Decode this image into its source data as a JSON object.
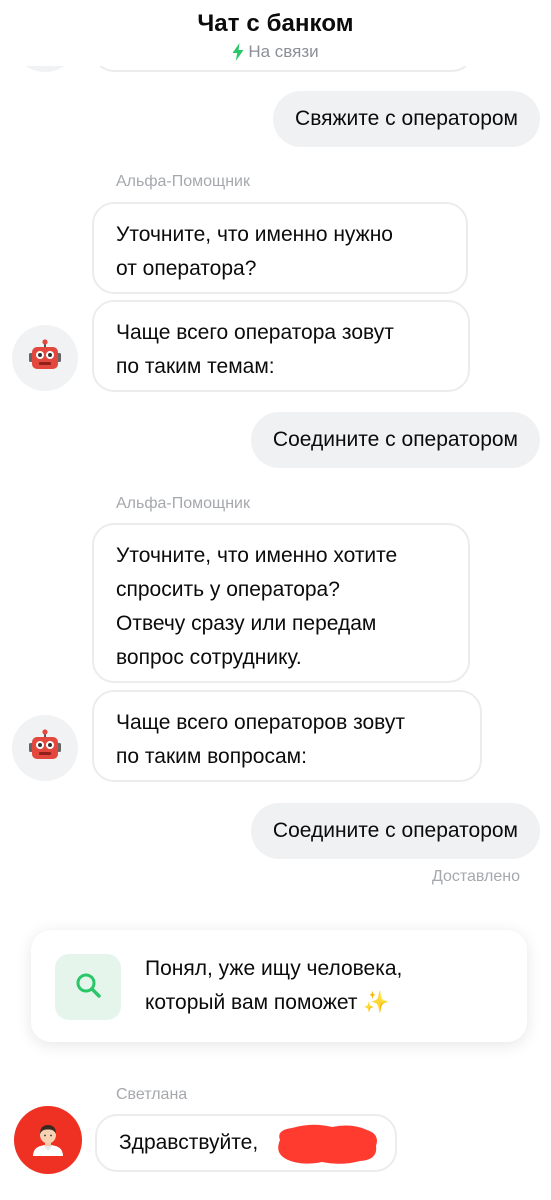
{
  "header": {
    "title": "Чат с банком",
    "status": "На связи",
    "status_icon": "bolt-icon",
    "status_color": "#2ac769"
  },
  "messages": {
    "user_1": "Свяжите с оператором",
    "bot_group_1": {
      "sender": "Альфа-Помощник",
      "bubble_1_lines": [
        "Уточните, что именно нужно",
        "от оператора?"
      ],
      "bubble_2_lines": [
        "Чаще всего оператора зовут",
        "по таким темам:"
      ]
    },
    "user_2": "Соедините с оператором",
    "bot_group_2": {
      "sender": "Альфа-Помощник",
      "bubble_1_lines": [
        "Уточните, что именно хотите",
        "спросить у оператора?",
        "Отвечу сразу или передам",
        "вопрос сотруднику."
      ],
      "bubble_2_lines": [
        "Чаще всего операторов зовут",
        "по таким вопросам:"
      ]
    },
    "user_3": "Соедините с оператором",
    "delivered": "Доставлено"
  },
  "search_card": {
    "icon": "search-icon",
    "line_1": "Понял, уже ищу человека,",
    "line_2": "который вам поможет",
    "sparkle": "✨"
  },
  "operator": {
    "name": "Светлана",
    "avatar_icon": "person-icon",
    "avatar_color": "#ef3124",
    "greeting": "Здравствуйте,"
  },
  "colors": {
    "accent_green": "#2ac769",
    "brand_red": "#ef3124",
    "user_bubble": "#f0f1f3",
    "bot_bubble_border": "#ececee"
  }
}
